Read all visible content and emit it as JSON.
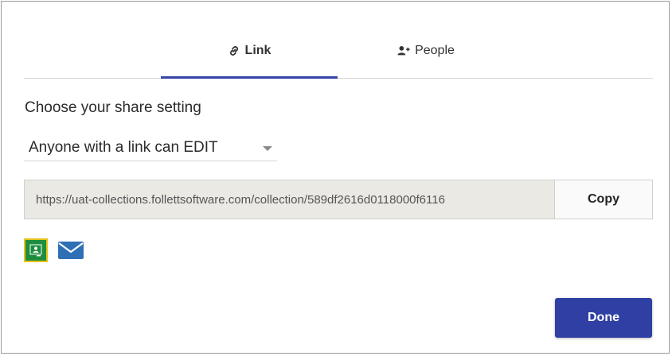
{
  "tabs": {
    "link_label": "Link",
    "people_label": "People",
    "active": "link"
  },
  "heading": "Choose your share setting",
  "share_setting": {
    "selected": "Anyone with a link can EDIT"
  },
  "link": {
    "url": "https://uat-collections.follettsoftware.com/collection/589df2616d0118000f6116",
    "copy_label": "Copy"
  },
  "share_icons": [
    "google-classroom-icon",
    "email-icon"
  ],
  "done_label": "Done",
  "colors": {
    "accent": "#3545a5",
    "done_button": "#2f3fa3",
    "classroom_green": "#1e8e3e",
    "classroom_border": "#e6c21a",
    "mail_blue": "#2f6fb6",
    "url_field_bg": "#eae9e4"
  }
}
